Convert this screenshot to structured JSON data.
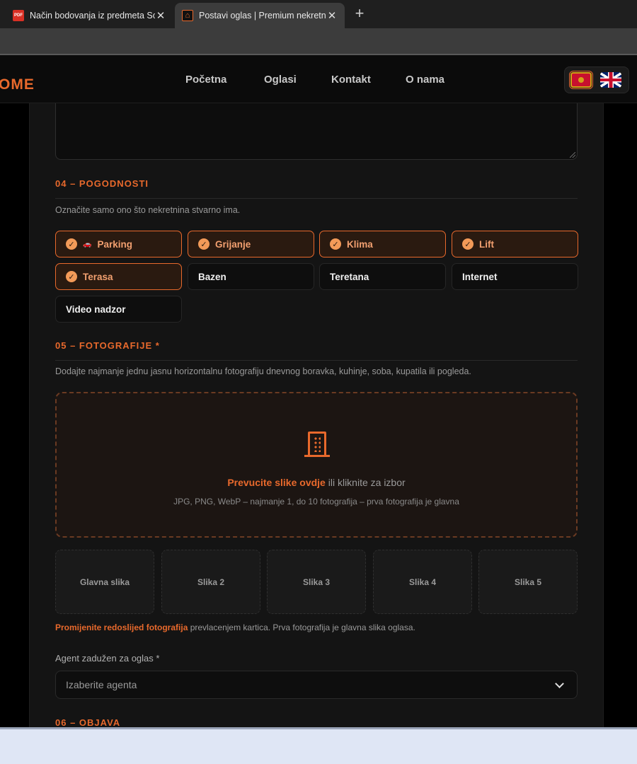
{
  "browser": {
    "tabs": [
      {
        "favicon": "PDF",
        "title": "Način bodovanja iz predmeta Soci",
        "close": "✕"
      },
      {
        "favicon": "⌂",
        "title": "Postavi oglas | Premium nekretnine",
        "close": "✕"
      }
    ],
    "new_tab": "+"
  },
  "header": {
    "logo": "OME",
    "nav": [
      "Početna",
      "Oglasi",
      "Kontakt",
      "O nama"
    ],
    "languages": [
      "me-flag-icon",
      "uk-flag-icon"
    ]
  },
  "amenities": {
    "title": "04 – POGODNOSTI",
    "description": "Označite samo ono što nekretnina stvarno ima.",
    "items": [
      {
        "label": "Parking",
        "checked": true
      },
      {
        "label": "Grijanje",
        "checked": true
      },
      {
        "label": "Klima",
        "checked": true
      },
      {
        "label": "Lift",
        "checked": true
      },
      {
        "label": "Terasa",
        "checked": true
      },
      {
        "label": "Bazen",
        "checked": false
      },
      {
        "label": "Teretana",
        "checked": false
      },
      {
        "label": "Internet",
        "checked": false
      },
      {
        "label": "Video nadzor",
        "checked": false
      }
    ]
  },
  "photos": {
    "title": "05 – FOTOGRAFIJE *",
    "description": "Dodajte najmanje jednu jasnu horizontalnu fotografiju dnevnog boravka, kuhinje, soba, kupatila ili pogleda.",
    "drop_strong": "Prevucite slike ovdje",
    "drop_rest": " ili kliknite za izbor",
    "drop_hint": "JPG, PNG, WebP – najmanje 1, do 10 fotografija – prva fotografija je glavna",
    "slots": [
      "Glavna slika",
      "Slika 2",
      "Slika 3",
      "Slika 4",
      "Slika 5"
    ],
    "reorder_strong": "Promijenite redoslijed fotografija",
    "reorder_rest": " prevlacenjem kartica. Prva fotografija je glavna slika oglasa."
  },
  "agent": {
    "label": "Agent zadužen za oglas *",
    "placeholder": "Izaberite agenta"
  },
  "publish": {
    "title": "06 – OBJAVA"
  },
  "colors": {
    "accent": "#e8692c",
    "background": "#141414"
  }
}
